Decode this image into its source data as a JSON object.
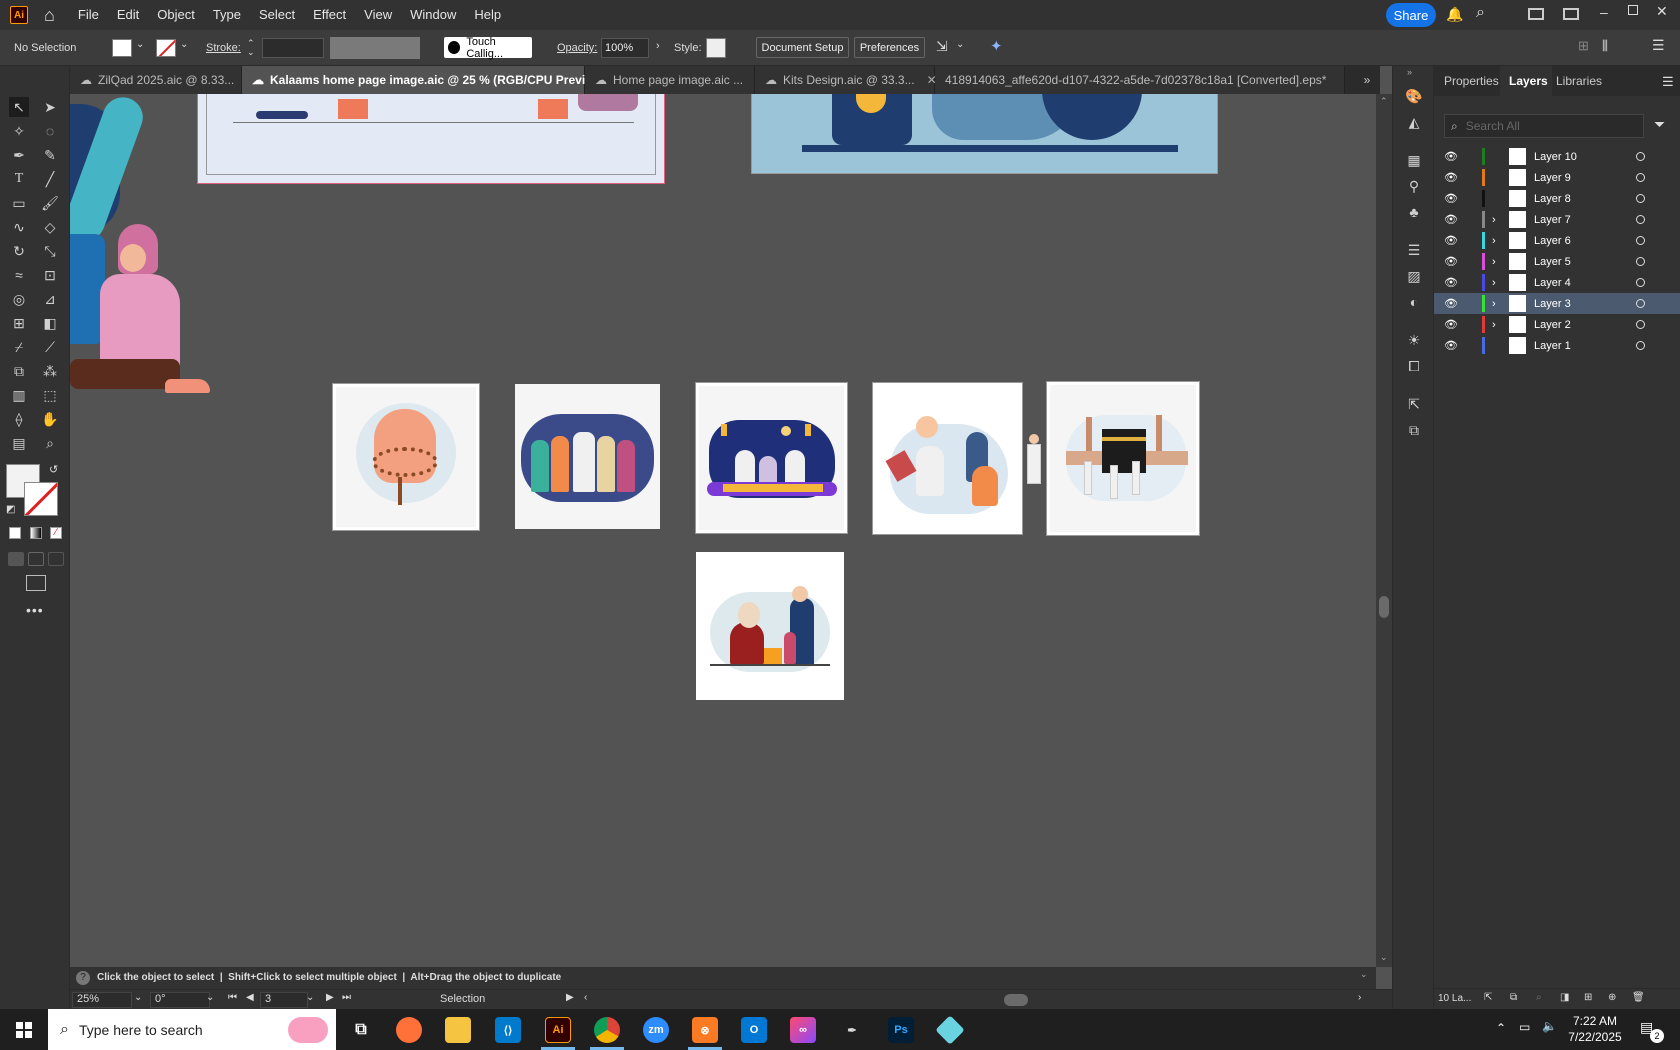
{
  "app": {
    "logo": "Ai",
    "share_label": "Share"
  },
  "menu": [
    "File",
    "Edit",
    "Object",
    "Type",
    "Select",
    "Effect",
    "View",
    "Window",
    "Help"
  ],
  "control": {
    "selection": "No Selection",
    "stroke_label": "Stroke:",
    "brush_name": "Touch Callig...",
    "opacity_label": "Opacity:",
    "opacity_value": "100%",
    "style_label": "Style:",
    "doc_setup": "Document Setup",
    "preferences": "Preferences"
  },
  "tabs": [
    {
      "label": "ZilQad 2025.aic @ 8.33...",
      "active": false
    },
    {
      "label": "Kalaams home page image.aic @ 25 % (RGB/CPU Preview)",
      "active": true
    },
    {
      "label": "Home page image.aic ...",
      "active": false
    },
    {
      "label": "Kits Design.aic @ 33.3...",
      "active": false
    },
    {
      "label": "418914063_affe620d-d107-4322-a5de-7d02378c18a1 [Converted].eps*",
      "active": false
    }
  ],
  "panel": {
    "tabs": [
      "Properties",
      "Layers",
      "Libraries"
    ],
    "search_placeholder": "Search All",
    "layers": [
      {
        "name": "Layer 10",
        "color": "#1e7d1e",
        "has_children": false
      },
      {
        "name": "Layer 9",
        "color": "#e07b1a",
        "has_children": false
      },
      {
        "name": "Layer 8",
        "color": "#111111",
        "has_children": false
      },
      {
        "name": "Layer 7",
        "color": "#888888",
        "has_children": true
      },
      {
        "name": "Layer 6",
        "color": "#3ad7e0",
        "has_children": true
      },
      {
        "name": "Layer 5",
        "color": "#d94fd9",
        "has_children": true
      },
      {
        "name": "Layer 4",
        "color": "#4a4ae0",
        "has_children": true
      },
      {
        "name": "Layer 3",
        "color": "#3ae03a",
        "has_children": true,
        "selected": true
      },
      {
        "name": "Layer 2",
        "color": "#e03a3a",
        "has_children": true
      },
      {
        "name": "Layer 1",
        "color": "#4a6ae0",
        "has_children": false
      }
    ],
    "footer_count": "10 La..."
  },
  "status": {
    "hint": "Click the object to select  |  Shift+Click to select multiple object  |  Alt+Drag the object to duplicate",
    "zoom": "25%",
    "rotation": "0°",
    "artboard": "3",
    "tool": "Selection"
  },
  "taskbar": {
    "search_placeholder": "Type here to search",
    "time": "7:22 AM",
    "date": "7/22/2025",
    "notif_count": "2"
  },
  "colors": {
    "accent": "#1473e6",
    "selected_layer": "#4b5a6e"
  }
}
